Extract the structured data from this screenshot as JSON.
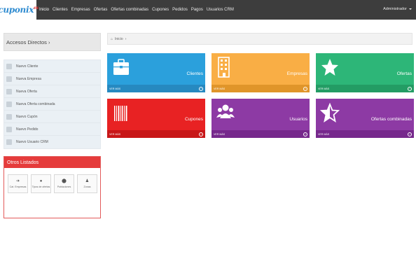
{
  "logo": {
    "text": "cuponix",
    "sup": "es"
  },
  "nav": [
    "Inicio",
    "Clientes",
    "Empresas",
    "Ofertas",
    "Ofertas combinadas",
    "Cupones",
    "Pedidos",
    "Pagos",
    "Usuarios CRM"
  ],
  "user": {
    "name": "Administrador"
  },
  "sidebar": {
    "title": "Accesos Directos ›",
    "items": [
      "Nuevo Cliente",
      "Nueva Empresa",
      "Nueva Oferta",
      "Nueva Oferta combinada",
      "Nuevo Cupón",
      "Nuevo Pedido",
      "Nuevo Usuario CRM"
    ]
  },
  "otros": {
    "title": "Otros Listados",
    "items": [
      "Cat. Empresas",
      "Tipos de ofertas",
      "Poblaciones",
      "Zonas"
    ]
  },
  "breadcrumb": {
    "home": "Inicio",
    "sep": "›"
  },
  "tiles": [
    {
      "title": "Clientes",
      "footer": "VER MÁS",
      "icon": "briefcase-icon",
      "color": "#2ba0dc",
      "foot_color": "#2689c0"
    },
    {
      "title": "Empresas",
      "footer": "VER MÁS",
      "icon": "building-icon",
      "color": "#f9ae45",
      "foot_color": "#e0952a"
    },
    {
      "title": "Ofertas",
      "footer": "VER MÁS",
      "icon": "star-icon",
      "color": "#2db678",
      "foot_color": "#239c64"
    },
    {
      "title": "Cupones",
      "footer": "VER MÁS",
      "icon": "barcode-icon",
      "color": "#e82223",
      "foot_color": "#c81718"
    },
    {
      "title": "Usuarios",
      "footer": "VER MÁS",
      "icon": "users-icon",
      "color": "#8d3aa4",
      "foot_color": "#76288c"
    },
    {
      "title": "Ofertas combinadas",
      "footer": "VER MÁS",
      "icon": "star-outline-icon",
      "color": "#8d3aa4",
      "foot_color": "#76288c"
    }
  ]
}
